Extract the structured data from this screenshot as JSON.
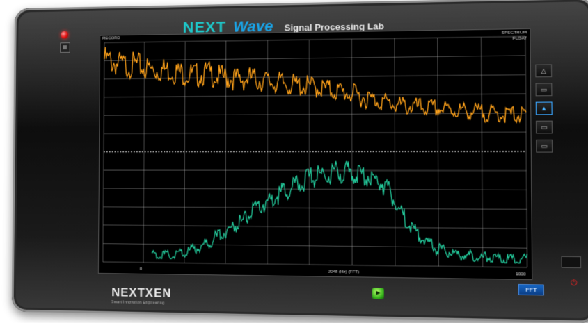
{
  "app": {
    "logo_next": "NEXT",
    "logo_wave": "Wave",
    "subtitle": "Signal Processing Lab"
  },
  "screen": {
    "label_top_left": "RECORD",
    "label_top_right": "SPECTRUM",
    "label_top_right_2": "FLOAT",
    "label_bottom_left": "0",
    "label_bottom_right": "1000",
    "label_axis": "2048 (Hz) (FFT)"
  },
  "brand": {
    "name": "NEXTXEN",
    "tagline": "Smart Innovation Engineering"
  },
  "controls": {
    "side_buttons": [
      "icon-1",
      "icon-2",
      "icon-3",
      "icon-4",
      "icon-5"
    ],
    "function_box": "FFT",
    "center_button": "►"
  },
  "colors": {
    "trace_top": "#ffa21a",
    "trace_bottom": "#23c89a",
    "grid": "#bfbfbf",
    "screen_bg": "#000000"
  },
  "chart_data": [
    {
      "type": "line",
      "title": "",
      "series": [
        {
          "values": [
            0.92,
            0.88,
            0.85,
            0.86,
            0.82,
            0.8,
            0.81,
            0.78,
            0.76,
            0.75,
            0.77,
            0.73,
            0.72,
            0.7,
            0.71,
            0.69,
            0.67,
            0.66,
            0.64,
            0.63,
            0.62,
            0.6,
            0.58,
            0.56,
            0.53,
            0.5,
            0.48,
            0.45,
            0.43,
            0.42,
            0.41,
            0.4,
            0.39,
            0.38,
            0.37,
            0.36,
            0.35,
            0.34,
            0.34,
            0.33
          ]
        }
      ],
      "ylim": [
        0,
        1
      ],
      "grid": true
    },
    {
      "type": "line",
      "title": "",
      "series": [
        {
          "values": [
            0.05,
            0.05,
            0.06,
            0.08,
            0.1,
            0.14,
            0.18,
            0.24,
            0.3,
            0.36,
            0.42,
            0.5,
            0.56,
            0.62,
            0.68,
            0.72,
            0.78,
            0.82,
            0.85,
            0.87,
            0.88,
            0.87,
            0.86,
            0.84,
            0.8,
            0.72,
            0.55,
            0.4,
            0.28,
            0.2,
            0.15,
            0.12,
            0.1,
            0.09,
            0.08,
            0.07,
            0.07,
            0.06,
            0.06,
            0.06
          ]
        }
      ],
      "ylim": [
        0,
        1
      ],
      "grid": true
    }
  ]
}
